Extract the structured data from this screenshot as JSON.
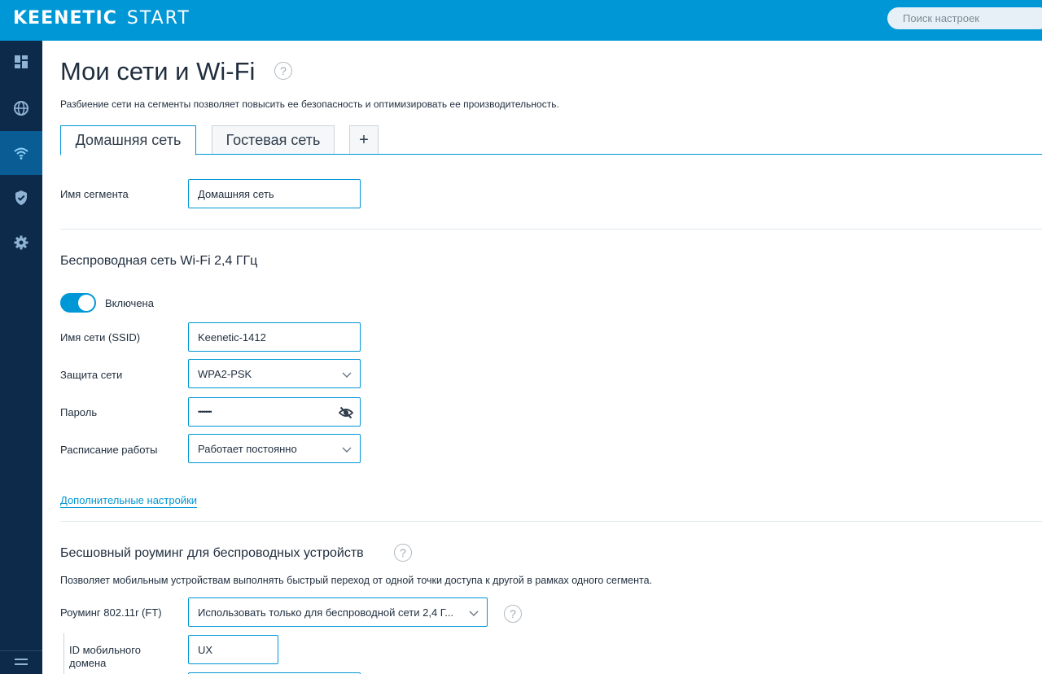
{
  "header": {
    "brand_main": "KEENETIC",
    "brand_sub": "START",
    "search_placeholder": "Поиск настроек"
  },
  "sidebar": {
    "items": [
      {
        "icon": "dashboard-icon",
        "active": false
      },
      {
        "icon": "globe-icon",
        "active": false
      },
      {
        "icon": "wifi-icon",
        "active": true
      },
      {
        "icon": "shield-icon",
        "active": false
      },
      {
        "icon": "gear-icon",
        "active": false
      }
    ],
    "bottom_icon": "menu-icon"
  },
  "page": {
    "title": "Мои сети и Wi-Fi",
    "help": "?",
    "description": "Разбиение сети на сегменты позволяет повысить ее безопасность и оптимизировать ее производительность."
  },
  "tabs": [
    {
      "label": "Домашняя сеть",
      "active": true
    },
    {
      "label": "Гостевая сеть",
      "active": false
    },
    {
      "label": "+",
      "active": false
    }
  ],
  "segment": {
    "name_label": "Имя сегмента",
    "name_value": "Домашняя сеть"
  },
  "wifi24": {
    "title": "Беспроводная сеть Wi-Fi 2,4 ГГц",
    "toggle_label": "Включена",
    "toggle_on": true,
    "ssid_label": "Имя сети (SSID)",
    "ssid_value": "Keenetic-1412",
    "security_label": "Защита сети",
    "security_value": "WPA2-PSK",
    "password_label": "Пароль",
    "password_value": "••••••••",
    "schedule_label": "Расписание работы",
    "schedule_value": "Работает постоянно",
    "advanced_link": "Дополнительные настройки"
  },
  "roaming": {
    "title": "Бесшовный роуминг для беспроводных устройств",
    "description": "Позволяет мобильным устройствам выполнять быстрый переход от одной точки доступа к другой в рамках одного сегмента.",
    "ft_label": "Роуминг 802.11r (FT)",
    "ft_value": "Использовать только для беспроводной сети 2,4 Г...",
    "mobility_domain_label_1": "ID мобильного",
    "mobility_domain_label_2": "домена",
    "mobility_domain_value": "UX"
  },
  "colors": {
    "accent": "#0097d6",
    "sidebar_bg": "#0e2a4a",
    "sidebar_active": "#0a5c95",
    "text": "#1f2d3d"
  }
}
